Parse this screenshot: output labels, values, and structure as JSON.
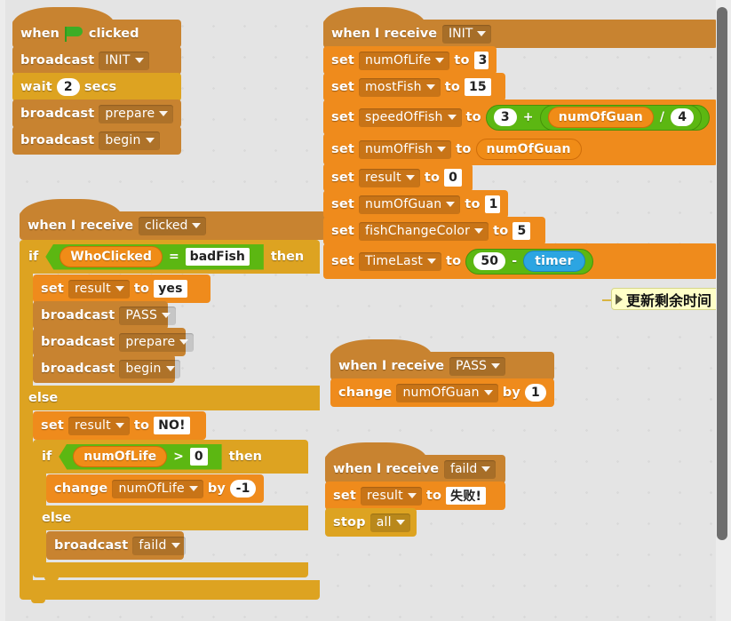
{
  "workspace": {
    "background_color": "#e4e4e4",
    "scrollbar": {
      "name": "vertical-scrollbar",
      "thumb_color": "#6e6e6e"
    }
  },
  "colors": {
    "events": "#c88330",
    "control": "#dda321",
    "data": "#ef8b1c",
    "operators": "#5cb712",
    "sensing": "#2ca5e2",
    "comment": "#ffffc8"
  },
  "scripts": {
    "green_flag": {
      "hat": {
        "when": "when",
        "clicked": "clicked",
        "icon": "green-flag-icon"
      },
      "blocks": [
        {
          "op": "broadcast",
          "label": "broadcast",
          "message": "INIT"
        },
        {
          "op": "wait",
          "label": "wait",
          "value": "2",
          "unit": "secs"
        },
        {
          "op": "broadcast",
          "label": "broadcast",
          "message": "prepare"
        },
        {
          "op": "broadcast",
          "label": "broadcast",
          "message": "begin"
        }
      ]
    },
    "when_clicked": {
      "hat": {
        "label": "when I receive",
        "message": "clicked"
      },
      "if_label": "if",
      "then_label": "then",
      "else_label": "else",
      "condition": {
        "left": "WhoClicked",
        "operator": "=",
        "right": "badFish"
      },
      "true_branch": [
        {
          "op": "set",
          "label": "set",
          "variable": "result",
          "to": "to",
          "value": "yes"
        },
        {
          "op": "broadcast",
          "label": "broadcast",
          "message": "PASS"
        },
        {
          "op": "broadcast",
          "label": "broadcast",
          "message": "prepare"
        },
        {
          "op": "broadcast",
          "label": "broadcast",
          "message": "begin"
        }
      ],
      "false_branch": {
        "set_result": {
          "label": "set",
          "variable": "result",
          "to": "to",
          "value": "NO!"
        },
        "inner_if": {
          "if_label": "if",
          "then_label": "then",
          "else_label": "else",
          "condition": {
            "left": "numOfLife",
            "operator": ">",
            "right": "0"
          },
          "true_branch": [
            {
              "op": "change",
              "label": "change",
              "variable": "numOfLife",
              "by": "by",
              "value": "-1"
            }
          ],
          "false_branch": [
            {
              "op": "broadcast",
              "label": "broadcast",
              "message": "faild"
            }
          ]
        }
      }
    },
    "when_init": {
      "hat": {
        "label": "when I receive",
        "message": "INIT"
      },
      "blocks": [
        {
          "label": "set",
          "variable": "numOfLife",
          "to": "to",
          "value": "3",
          "value_kind": "text"
        },
        {
          "label": "set",
          "variable": "mostFish",
          "to": "to",
          "value": "15",
          "value_kind": "text"
        },
        {
          "label": "set",
          "variable": "speedOfFish",
          "to": "to",
          "value_kind": "operator",
          "expr": {
            "type": "add",
            "left": "3",
            "symbol": "+",
            "right": {
              "type": "divide",
              "left": "numOfGuan",
              "symbol": "/",
              "right": "4"
            }
          }
        },
        {
          "label": "set",
          "variable": "numOfFish",
          "to": "to",
          "value": "numOfGuan",
          "value_kind": "variable"
        },
        {
          "label": "set",
          "variable": "result",
          "to": "to",
          "value": "0",
          "value_kind": "text"
        },
        {
          "label": "set",
          "variable": "numOfGuan",
          "to": "to",
          "value": "1",
          "value_kind": "text"
        },
        {
          "label": "set",
          "variable": "fishChangeColor",
          "to": "to",
          "value": "5",
          "value_kind": "text"
        },
        {
          "label": "set",
          "variable": "TimeLast",
          "to": "to",
          "value_kind": "operator",
          "expr": {
            "type": "subtract",
            "left": "50",
            "symbol": "-",
            "right": "timer",
            "right_kind": "sensing"
          },
          "comment": "更新剩余时间"
        }
      ]
    },
    "when_pass": {
      "hat": {
        "label": "when I receive",
        "message": "PASS"
      },
      "blocks": [
        {
          "label": "change",
          "variable": "numOfGuan",
          "by": "by",
          "value": "1"
        }
      ]
    },
    "when_faild": {
      "hat": {
        "label": "when I receive",
        "message": "faild"
      },
      "blocks": [
        {
          "label": "set",
          "variable": "result",
          "to": "to",
          "value": "失败!"
        },
        {
          "label": "stop",
          "option": "all"
        }
      ]
    }
  }
}
